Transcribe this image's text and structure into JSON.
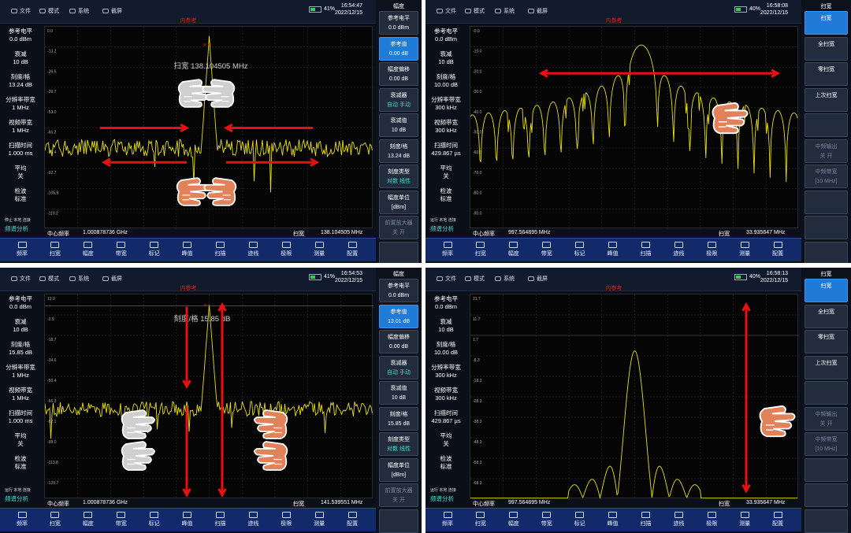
{
  "panels": [
    {
      "menu": {
        "file": "文件",
        "mode": "模式",
        "system": "系统",
        "screenshot": "截屏"
      },
      "battery": "41%",
      "time": "16:54:47",
      "date": "2022/12/15",
      "banner": "内参考",
      "left": [
        [
          "参考电平",
          "0.0 dBm"
        ],
        [
          "衰减",
          "10 dB"
        ],
        [
          "刻度/格",
          "13.24 dB"
        ],
        [
          "分辨率带宽",
          "1 MHz"
        ],
        [
          "视频带宽",
          "1 MHz"
        ],
        [
          "扫描时间",
          "1.000 ms"
        ],
        [
          "平均",
          "关"
        ],
        [
          "检波",
          "标准"
        ]
      ],
      "status": "停止 本地 连接",
      "mode_label": "频谱分析",
      "center": "中心频率",
      "center_val": "1.000878736 GHz",
      "span": "扫宽",
      "span_val": "138.104505 MHz",
      "overlay": "扫宽  138.104505 MHz",
      "ylabels": [
        "0.0",
        "-13.2",
        "-26.5",
        "-39.7",
        "-53.0",
        "-66.2",
        "-79.4",
        "-92.7",
        "-105.9",
        "-119.2"
      ],
      "right": {
        "title": "幅度",
        "buttons": [
          [
            "参考电平",
            "0.0 dBm"
          ],
          [
            "参考值",
            "0.00 dB"
          ],
          [
            "幅度偏移",
            "0.00 dB"
          ],
          [
            "衰减器",
            "自动  手动"
          ],
          [
            "衰减值",
            "10 dB"
          ],
          [
            "刻度/格",
            "13.24 dB"
          ],
          [
            "刻度类型",
            "对数  线性"
          ],
          [
            "幅度单位",
            "[dBm]"
          ],
          [
            "前置放大器",
            "关  开"
          ],
          [
            "",
            ""
          ]
        ],
        "active": 1
      }
    },
    {
      "menu": {
        "file": "文件",
        "mode": "模式",
        "system": "系统",
        "screenshot": "截屏"
      },
      "battery": "40%",
      "time": "16:58:08",
      "date": "2022/12/15",
      "banner": "内参考",
      "left": [
        [
          "参考电平",
          "0.0 dBm"
        ],
        [
          "衰减",
          "10 dB"
        ],
        [
          "刻度/格",
          "10.00 dB"
        ],
        [
          "分辨率带宽",
          "300 kHz"
        ],
        [
          "视频带宽",
          "300 kHz"
        ],
        [
          "扫描时间",
          "429.867 µs"
        ],
        [
          "平均",
          "关"
        ],
        [
          "检波",
          "标准"
        ]
      ],
      "status": "运行 本地 连接",
      "mode_label": "频谱分析",
      "center": "中心频率",
      "center_val": "997.564895 MHz",
      "span": "扫宽",
      "span_val": "33.935647 MHz",
      "overlay": "",
      "ylabels": [
        "-0.0",
        "-10.0",
        "-20.0",
        "-30.0",
        "-40.0",
        "-50.0",
        "-60.0",
        "-70.0",
        "-80.0",
        "-90.0"
      ],
      "right": {
        "title": "扫宽",
        "buttons": [
          [
            "扫宽",
            ""
          ],
          [
            "全扫宽",
            ""
          ],
          [
            "零扫宽",
            ""
          ],
          [
            "上次扫宽",
            ""
          ],
          [
            "",
            ""
          ],
          [
            "中频输出",
            "关  开"
          ],
          [
            "中频带宽",
            "[10 MHz]"
          ],
          [
            "",
            ""
          ],
          [
            "",
            ""
          ],
          [
            "",
            ""
          ]
        ],
        "active": 0
      }
    },
    {
      "menu": {
        "file": "文件",
        "mode": "模式",
        "system": "系统",
        "screenshot": "截屏"
      },
      "battery": "41%",
      "time": "16:54:53",
      "date": "2022/12/15",
      "banner": "内参考",
      "left": [
        [
          "参考电平",
          "0.0 dBm"
        ],
        [
          "衰减",
          "10 dB"
        ],
        [
          "刻度/格",
          "15.85 dB"
        ],
        [
          "分辨率带宽",
          "1 MHz"
        ],
        [
          "视频带宽",
          "1 MHz"
        ],
        [
          "扫描时间",
          "1.000 ms"
        ],
        [
          "平均",
          "关"
        ],
        [
          "检波",
          "标准"
        ]
      ],
      "status": "运行 本地 连接",
      "mode_label": "频谱分析",
      "center": "中心频率",
      "center_val": "1.000878736 GHz",
      "span": "扫宽",
      "span_val": "141.539551 MHz",
      "overlay": "刻度/格  15.85 dB",
      "ylabels": [
        "13.0",
        "-2.9",
        "-18.7",
        "-34.6",
        "-50.4",
        "-66.3",
        "-82.1",
        "-98.0",
        "-113.8",
        "-129.7"
      ],
      "right": {
        "title": "幅度",
        "buttons": [
          [
            "参考电平",
            "0.0 dBm"
          ],
          [
            "参考值",
            "13.01 dB"
          ],
          [
            "幅度偏移",
            "0.00 dB"
          ],
          [
            "衰减器",
            "自动  手动"
          ],
          [
            "衰减值",
            "10 dB"
          ],
          [
            "刻度/格",
            "15.85 dB"
          ],
          [
            "刻度类型",
            "对数  线性"
          ],
          [
            "幅度单位",
            "[dBm]"
          ],
          [
            "前置放大器",
            "关  开"
          ],
          [
            "",
            ""
          ]
        ],
        "active": 1
      }
    },
    {
      "menu": {
        "file": "文件",
        "mode": "模式",
        "system": "系统",
        "screenshot": "截屏"
      },
      "battery": "40%",
      "time": "16:58:13",
      "date": "2022/12/15",
      "banner": "内参考",
      "left": [
        [
          "参考电平",
          "0.0 dBm"
        ],
        [
          "衰减",
          "10 dB"
        ],
        [
          "刻度/格",
          "10.00 dB"
        ],
        [
          "分辨率带宽",
          "300 kHz"
        ],
        [
          "视频带宽",
          "300 kHz"
        ],
        [
          "扫描时间",
          "429.867 µs"
        ],
        [
          "平均",
          "关"
        ],
        [
          "检波",
          "标准"
        ]
      ],
      "status": "运行 本地 连接",
      "mode_label": "频谱分析",
      "center": "中心频率",
      "center_val": "997.564895 MHz",
      "span": "扫宽",
      "span_val": "33.935647 MHz",
      "overlay": "",
      "ylabels": [
        "21.7",
        "11.7",
        "1.7",
        "-8.3",
        "-18.3",
        "-28.3",
        "-38.3",
        "-48.3",
        "-58.3",
        "-68.3"
      ],
      "right": {
        "title": "扫宽",
        "buttons": [
          [
            "扫宽",
            ""
          ],
          [
            "全扫宽",
            ""
          ],
          [
            "零扫宽",
            ""
          ],
          [
            "上次扫宽",
            ""
          ],
          [
            "",
            ""
          ],
          [
            "中频输出",
            "关  开"
          ],
          [
            "中频带宽",
            "[10 MHz]"
          ],
          [
            "",
            ""
          ],
          [
            "",
            ""
          ],
          [
            "",
            ""
          ]
        ],
        "active": 0
      }
    }
  ],
  "toolbar": [
    "频率",
    "扫宽",
    "幅度",
    "带宽",
    "标记",
    "峰值",
    "扫描",
    "迹线",
    "极限",
    "测量",
    "配置"
  ],
  "colors": {
    "trace": "#e8e000",
    "accent": "#1f7ad8",
    "banner": "#e01818",
    "arrow": "#e81010",
    "hand": "#e2825a",
    "handGray": "#d8d8d8"
  }
}
